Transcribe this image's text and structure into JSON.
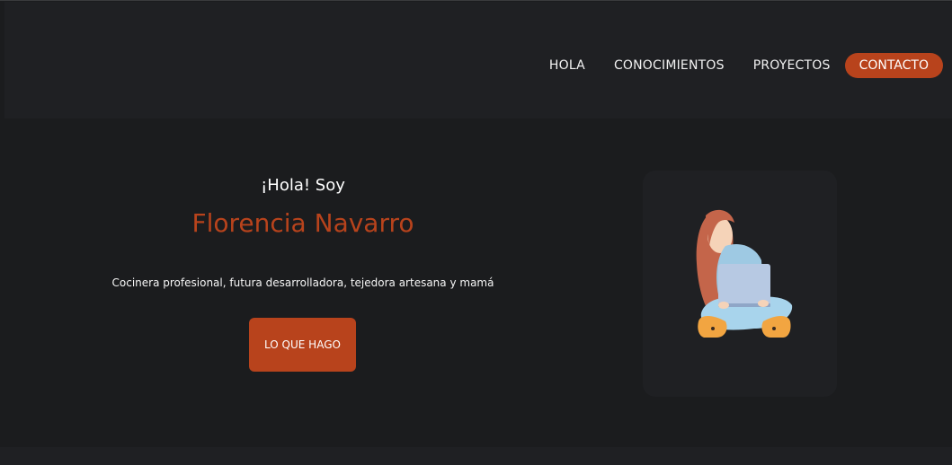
{
  "nav": {
    "links": [
      {
        "label": "HOLA"
      },
      {
        "label": "CONOCIMIENTOS"
      },
      {
        "label": "PROYECTOS"
      }
    ],
    "cta_label": "CONTACTO"
  },
  "hero": {
    "greeting": "¡Hola! Soy",
    "name": "Florencia Navarro",
    "description": "Cocinera profesional, futura desarrolladora, tejedora artesana y mamá",
    "button_label": "LO QUE HAGO"
  },
  "illustration": {
    "icon": "woman-with-laptop-illustration",
    "colors": {
      "hair": "#c4654a",
      "skin": "#f5d3b8",
      "shirt": "#9ec9e3",
      "laptop": "#b7c9e3",
      "pants": "#a8d4ec",
      "shoes": "#f2a541"
    }
  },
  "colors": {
    "accent": "#b8431c",
    "background": "#1b1c1e",
    "surface": "#1f2023"
  }
}
